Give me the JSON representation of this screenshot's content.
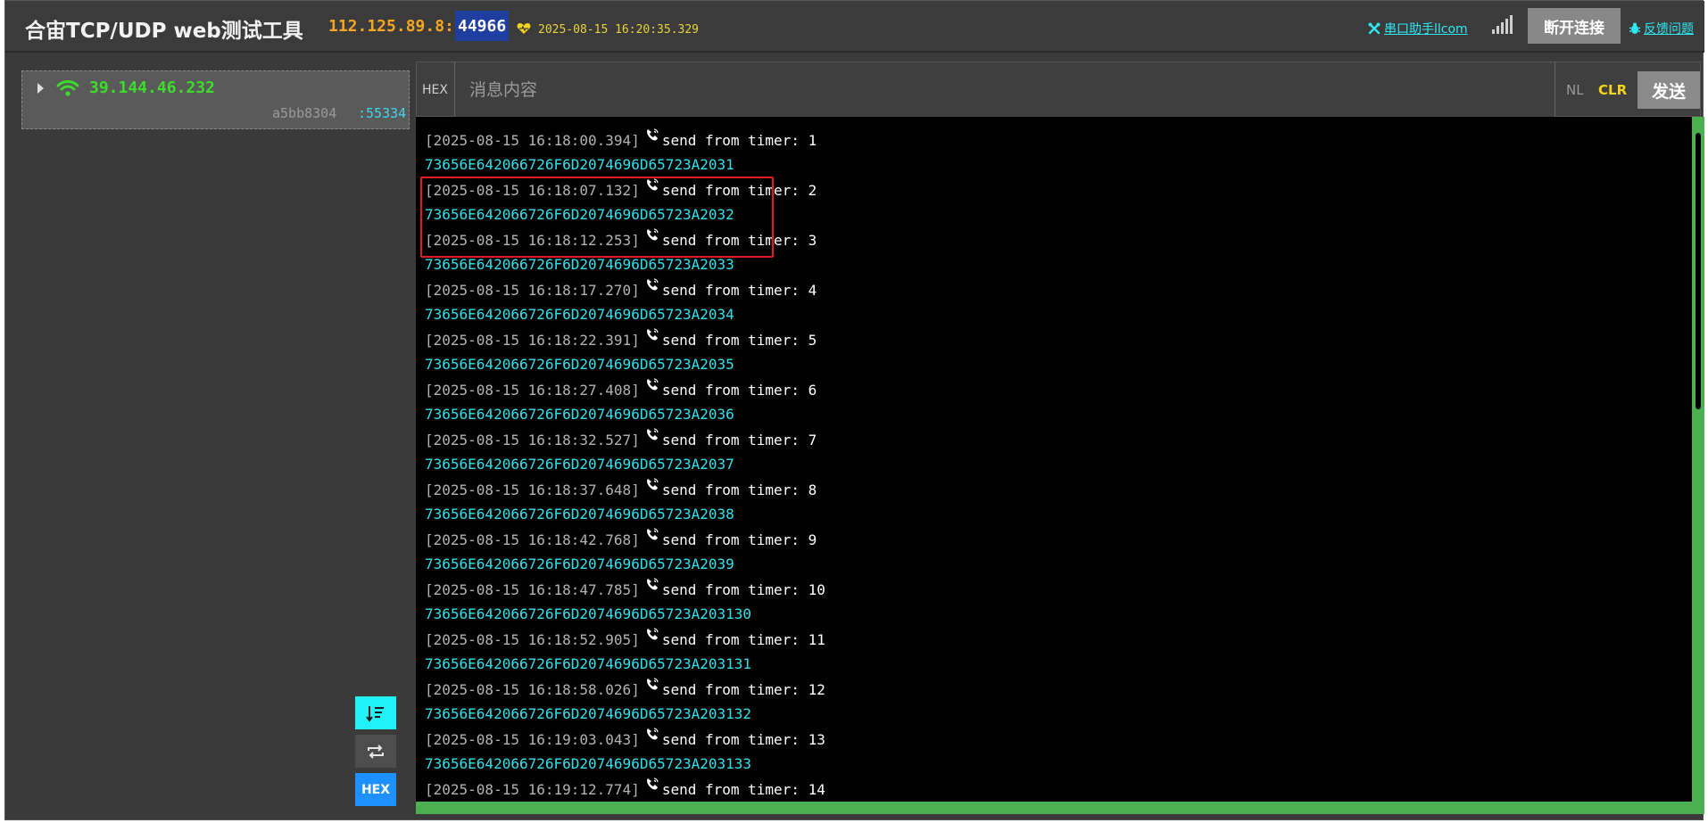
{
  "header": {
    "title": "合宙TCP/UDP web测试工具",
    "server_addr": "112.125.89.8:",
    "server_port": "44966",
    "server_time": "2025-08-15 16:20:35.329",
    "serial_link_label": "串口助手llcom",
    "disconnect_label": "断开连接",
    "feedback_label": "反馈问题"
  },
  "client": {
    "ip": "39.144.46.232",
    "id": "a5bb8304",
    "port": ":55334"
  },
  "sidebar": {
    "hex_label": "HEX"
  },
  "input_bar": {
    "hex_label": "HEX",
    "placeholder": "消息内容",
    "nl_label": "NL",
    "clr_label": "CLR",
    "send_label": "发送"
  },
  "log": [
    {
      "ts": "[2025-08-15 16:18:00.394]",
      "msg": "send from timer: 1",
      "hex": "73656E642066726F6D2074696D65723A2031"
    },
    {
      "ts": "[2025-08-15 16:18:07.132]",
      "msg": "send from timer: 2",
      "hex": "73656E642066726F6D2074696D65723A2032"
    },
    {
      "ts": "[2025-08-15 16:18:12.253]",
      "msg": "send from timer: 3",
      "hex": "73656E642066726F6D2074696D65723A2033"
    },
    {
      "ts": "[2025-08-15 16:18:17.270]",
      "msg": "send from timer: 4",
      "hex": "73656E642066726F6D2074696D65723A2034"
    },
    {
      "ts": "[2025-08-15 16:18:22.391]",
      "msg": "send from timer: 5",
      "hex": "73656E642066726F6D2074696D65723A2035"
    },
    {
      "ts": "[2025-08-15 16:18:27.408]",
      "msg": "send from timer: 6",
      "hex": "73656E642066726F6D2074696D65723A2036"
    },
    {
      "ts": "[2025-08-15 16:18:32.527]",
      "msg": "send from timer: 7",
      "hex": "73656E642066726F6D2074696D65723A2037"
    },
    {
      "ts": "[2025-08-15 16:18:37.648]",
      "msg": "send from timer: 8",
      "hex": "73656E642066726F6D2074696D65723A2038"
    },
    {
      "ts": "[2025-08-15 16:18:42.768]",
      "msg": "send from timer: 9",
      "hex": "73656E642066726F6D2074696D65723A2039"
    },
    {
      "ts": "[2025-08-15 16:18:47.785]",
      "msg": "send from timer: 10",
      "hex": "73656E642066726F6D2074696D65723A203130"
    },
    {
      "ts": "[2025-08-15 16:18:52.905]",
      "msg": "send from timer: 11",
      "hex": "73656E642066726F6D2074696D65723A203131"
    },
    {
      "ts": "[2025-08-15 16:18:58.026]",
      "msg": "send from timer: 12",
      "hex": "73656E642066726F6D2074696D65723A203132"
    },
    {
      "ts": "[2025-08-15 16:19:03.043]",
      "msg": "send from timer: 13",
      "hex": "73656E642066726F6D2074696D65723A203133"
    },
    {
      "ts": "[2025-08-15 16:19:12.774]",
      "msg": "send from timer: 14",
      "hex": ""
    }
  ],
  "colors": {
    "accent_cyan": "#2ee8f5",
    "client_ip_green": "#3ddc2a",
    "scrollbar_green": "#4caf50",
    "highlight_red": "#e21b1b"
  }
}
